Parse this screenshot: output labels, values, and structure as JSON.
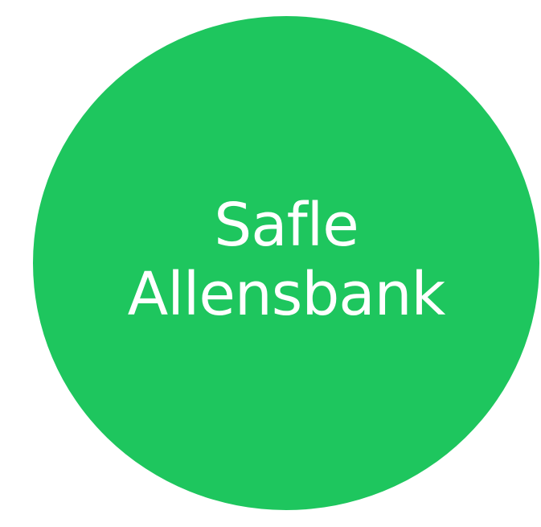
{
  "badge": {
    "line1": "Safle",
    "line2": "Allensbank",
    "fill_color": "#1ec65e",
    "text_color": "#ffffff"
  }
}
